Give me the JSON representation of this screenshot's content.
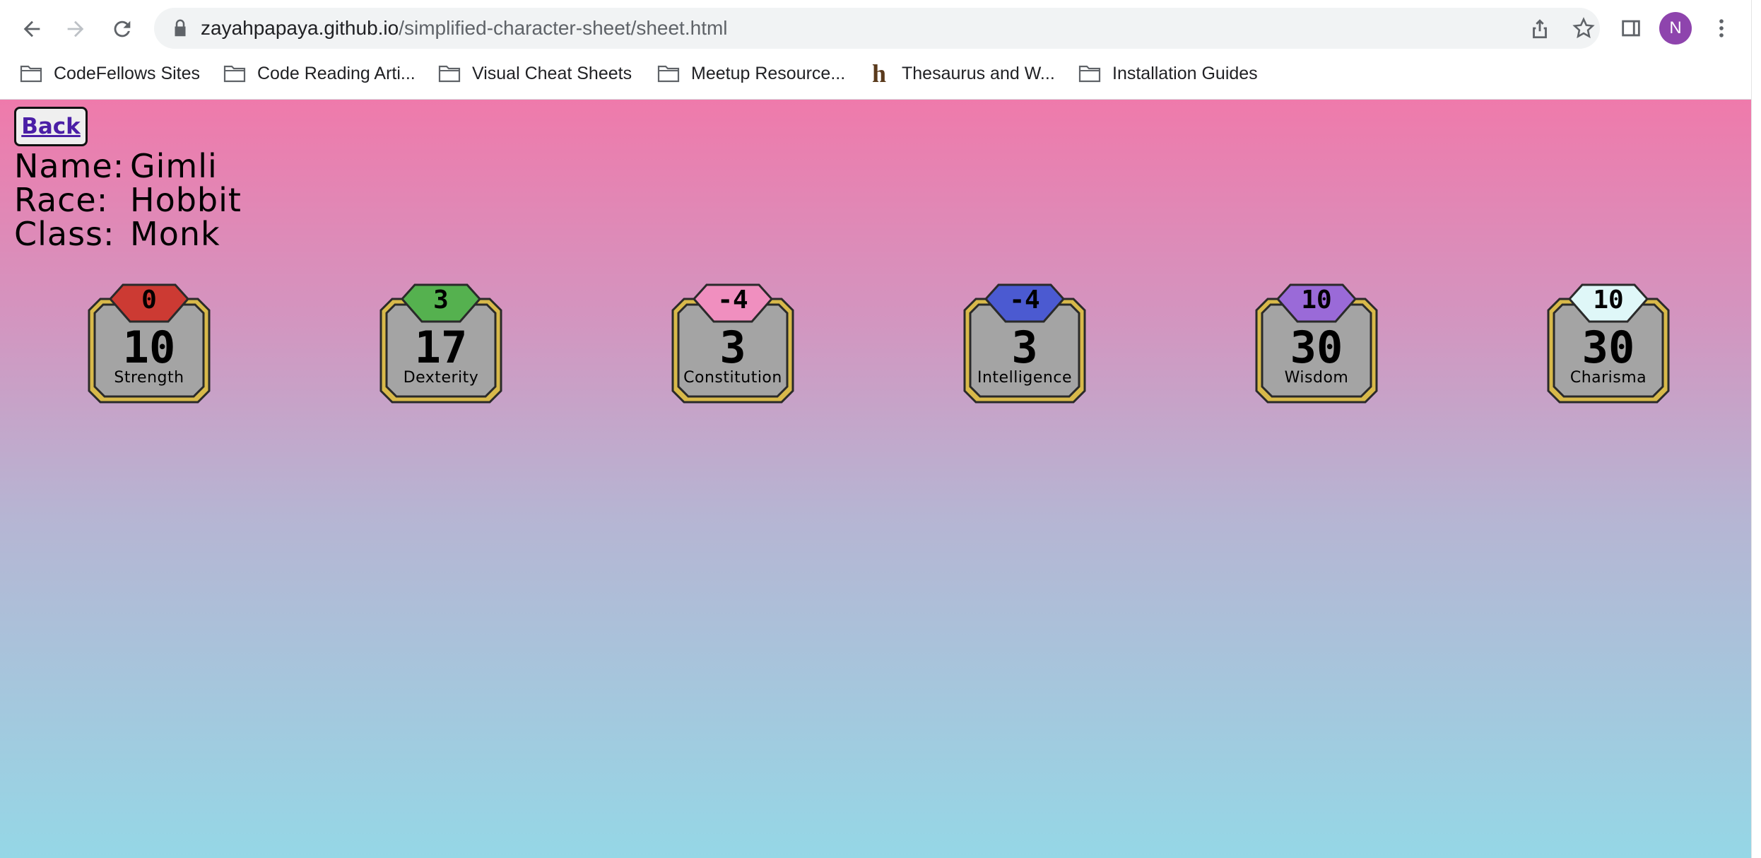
{
  "browser": {
    "url_host": "zayahpapaya.github.io",
    "url_path": "/simplified-character-sheet/sheet.html",
    "profile_initial": "N"
  },
  "bookmarks": [
    {
      "label": "CodeFellows Sites",
      "icon": "folder-icon"
    },
    {
      "label": "Code Reading Arti...",
      "icon": "folder-icon"
    },
    {
      "label": "Visual Cheat Sheets",
      "icon": "folder-icon"
    },
    {
      "label": "Meetup Resource...",
      "icon": "folder-icon"
    },
    {
      "label": "Thesaurus and W...",
      "icon": "hinative-h-icon"
    },
    {
      "label": "Installation Guides",
      "icon": "folder-icon"
    }
  ],
  "page": {
    "back_label": "Back",
    "name_label": "Name:",
    "name_value": "Gimli",
    "race_label": "Race:",
    "race_value": "Hobbit",
    "class_label": "Class:",
    "class_value": "Monk"
  },
  "stats": [
    {
      "name": "Strength",
      "score": "10",
      "modifier": "0",
      "color": "#cc3a33"
    },
    {
      "name": "Dexterity",
      "score": "17",
      "modifier": "3",
      "color": "#55b14f"
    },
    {
      "name": "Constitution",
      "score": "3",
      "modifier": "-4",
      "color": "#f08fbf"
    },
    {
      "name": "Intelligence",
      "score": "3",
      "modifier": "-4",
      "color": "#4b5ad1"
    },
    {
      "name": "Wisdom",
      "score": "30",
      "modifier": "10",
      "color": "#9a6ad8"
    },
    {
      "name": "Charisma",
      "score": "30",
      "modifier": "10",
      "color": "#dff7f8"
    }
  ]
}
